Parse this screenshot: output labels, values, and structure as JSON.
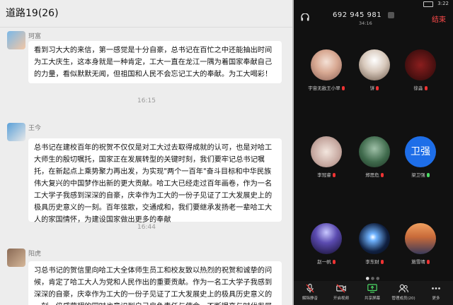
{
  "chat": {
    "title": "道路19(26)",
    "messages": [
      {
        "sender": "珂富",
        "text": "看到习大大的来信，第一感觉是十分自豪，总书记在百忙之中还能抽出时间为工大庆生，这本身就是一种肯定，工大一直在龙江一隅为着国家奉献自己的力量，看似默默无闻，但祖国和人民不会忘记工大的奉献。为工大喝彩！"
      },
      {
        "time": "16:15"
      },
      {
        "sender": "王今",
        "text": "总书记在建校百年的祝贺不仅仅是对工大过去取得成就的认可，也是对哈工大师生的殷切嘱托，国家正在发展转型的关键时刻，我们要牢记总书记嘱托，在新起点上乘势聚力再出发，为实现\"两个一百年\"奋斗目标和中华民族伟大复兴的中国梦作出新的更大贡献。哈工大已经走过百年画卷，作为一名工大学子我感到深深的自豪，庆幸作为工大的一份子见证了工大发展史上的极具历史意义的一刻。百年弦歌，交通成和，我们要继承发扬老一辈哈工大人的家国情怀，为建设国家做出更多的奉献"
      },
      {
        "time": "16:44"
      },
      {
        "sender": "阳虎",
        "text": "习总书记的贺信里向哈工大全体师生员工和校友致以热烈的祝贺和诚挚的问候，肯定了哈工大人为党和人民作出的重要贡献。作为一名工大学子我感到深深的自豪，庆幸作为工大的一份子见证了工大发展史上的极具历史意义的一刻，倍感荣耀的同时也意识到自己肩负责任与使命，不断提高与时代发展要求相适应的素质和能力，努力成为社会和国"
      }
    ]
  },
  "call": {
    "status_time": "3:22",
    "meeting_number": "692 945 981",
    "duration": "34:16",
    "end_label": "结束",
    "participants": [
      {
        "name": "宇宙无敌王小翠",
        "muted": true
      },
      {
        "name": "饼",
        "muted": true
      },
      {
        "name": "徐淼",
        "muted": true
      },
      {
        "name": "李冠睿",
        "muted": true
      },
      {
        "name": "郑思危",
        "muted": true
      },
      {
        "name": "梁卫强",
        "muted": false,
        "initials": "卫强"
      },
      {
        "name": "赵一帆",
        "muted": true
      },
      {
        "name": "李东财",
        "muted": true
      },
      {
        "name": "施雪晴",
        "muted": true
      }
    ],
    "toolbar": {
      "mute": "解除静音",
      "video": "开启视频",
      "share": "共享屏幕",
      "members": "管理成员(20)",
      "more": "更多"
    }
  },
  "colors": {
    "end": "#ff4a4a",
    "accent_blue": "#1e6ee8",
    "muted_mic": "#e33333"
  }
}
